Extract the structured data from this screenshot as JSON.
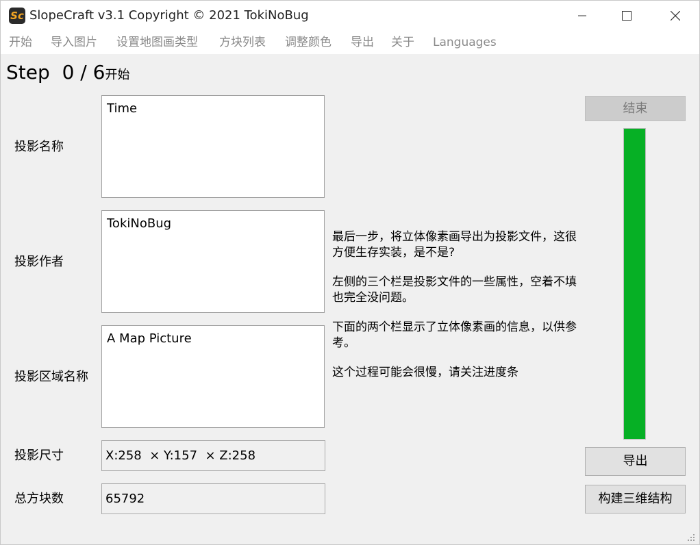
{
  "window": {
    "title": "SlopeCraft v3.1  Copyright © 2021 TokiNoBug",
    "app_icon_text": "Sc"
  },
  "menu": {
    "items": [
      "开始",
      "导入图片",
      "设置地图画类型",
      "方块列表",
      "调整颜色",
      "导出",
      "关于",
      "Languages"
    ]
  },
  "step": {
    "label": "Step",
    "progress_text": "0 / 6",
    "name": "开始"
  },
  "fields": {
    "name": {
      "label": "投影名称",
      "value": "Time"
    },
    "author": {
      "label": "投影作者",
      "value": "TokiNoBug"
    },
    "region": {
      "label": "投影区域名称",
      "value": "A Map Picture"
    },
    "size": {
      "label": "投影尺寸",
      "value": "X:258  × Y:157  × Z:258"
    },
    "block_count": {
      "label": "总方块数",
      "value": "65792"
    }
  },
  "description": [
    "最后一步，将立体像素画导出为投影文件，这很方便生存实装，是不是?",
    "左侧的三个栏是投影文件的一些属性，空着不填也完全没问题。",
    "下面的两个栏显示了立体像素画的信息，以供参考。",
    "这个过程可能会很慢，请关注进度条"
  ],
  "buttons": {
    "finish": "结束",
    "export": "导出",
    "build_3d": "构建三维结构"
  },
  "progress": {
    "fraction": 1.0,
    "color": "#06b025"
  },
  "colors": {
    "background": "#f0f0f0",
    "menu_text": "#8a8a8a"
  }
}
